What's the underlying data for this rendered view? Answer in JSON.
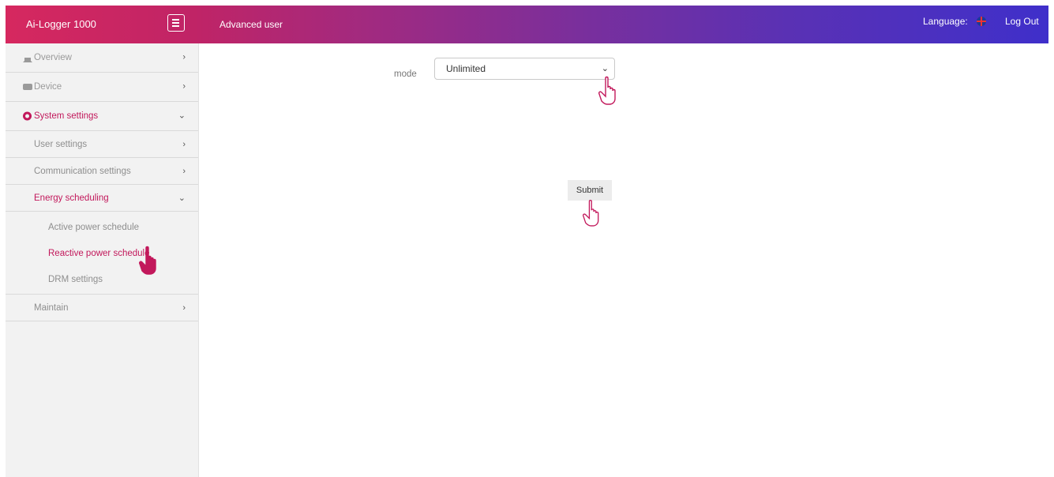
{
  "header": {
    "brand": "Ai-Logger 1000",
    "role": "Advanced user",
    "language_label": "Language:",
    "logout_label": "Log Out"
  },
  "sidebar": {
    "items": [
      {
        "label": "Overview",
        "icon": "home-icon"
      },
      {
        "label": "Device",
        "icon": "device-icon"
      },
      {
        "label": "System settings",
        "icon": "gear-icon"
      },
      {
        "label": "User settings"
      },
      {
        "label": "Communication settings"
      },
      {
        "label": "Energy scheduling"
      },
      {
        "label": "Active power schedule"
      },
      {
        "label": "Reactive power schedule"
      },
      {
        "label": "DRM settings"
      },
      {
        "label": "Maintain"
      }
    ]
  },
  "form": {
    "mode_label": "mode",
    "mode_value": "Unlimited",
    "submit_label": "Submit"
  },
  "colors": {
    "accent": "#c2185b",
    "header_start": "#d6285f",
    "header_end": "#3f2fca"
  }
}
